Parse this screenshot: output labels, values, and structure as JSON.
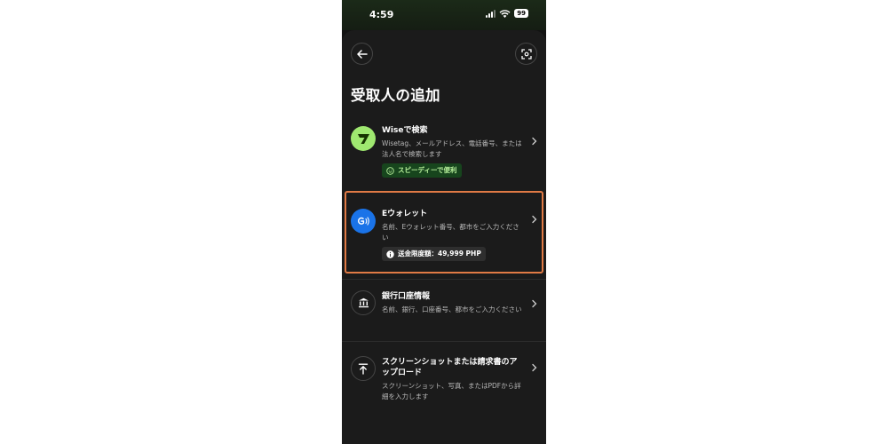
{
  "status_bar": {
    "time": "4:59",
    "battery": "99"
  },
  "header": {
    "back_icon": "arrow-left-icon",
    "scan_icon": "scan-icon"
  },
  "page": {
    "title": "受取人の追加"
  },
  "options": [
    {
      "title": "Wiseで検索",
      "description": "Wisetag、メールアドレス、電話番号、または法人名で検索します",
      "badge": "スピーディーで便利",
      "icon": "wise-logo-icon",
      "badge_icon": "smile-icon"
    },
    {
      "title": "Eウォレット",
      "description": "名前、Eウォレット番号、都市をご入力ください",
      "badge": "送金限度額：49,999 PHP",
      "icon": "ewallet-icon",
      "badge_icon": "info-icon"
    },
    {
      "title": "銀行口座情報",
      "description": "名前、銀行、口座番号、都市をご入力ください",
      "icon": "bank-icon"
    },
    {
      "title": "スクリーンショットまたは請求書のアップロード",
      "description": "スクリーンショット、写真、またはPDFから詳細を入力します",
      "icon": "upload-icon"
    }
  ],
  "colors": {
    "wise_green": "#9fe870",
    "ewallet_blue": "#1a73e8",
    "highlight_orange": "#e07a45"
  }
}
